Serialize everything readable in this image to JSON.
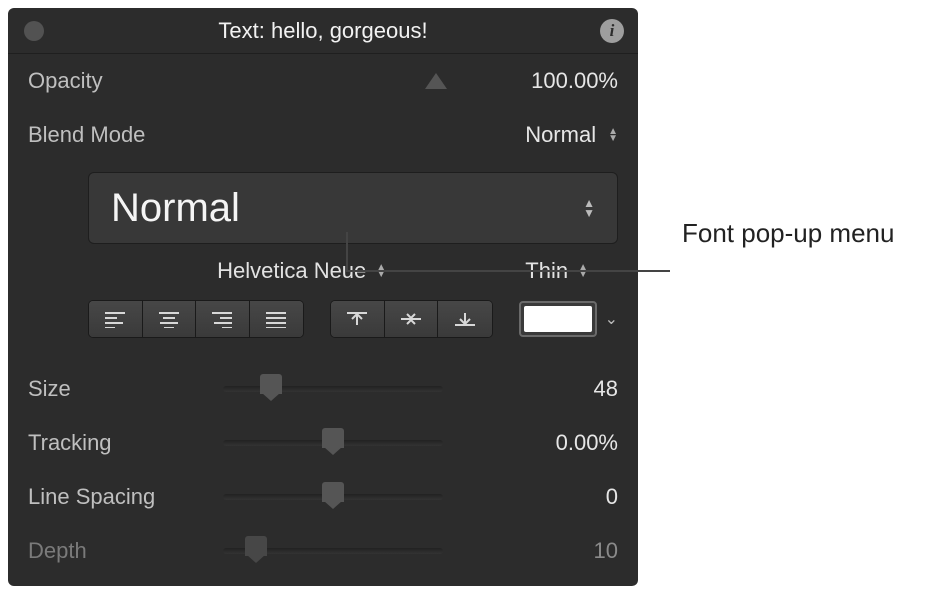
{
  "header": {
    "title": "Text: hello, gorgeous!"
  },
  "opacity": {
    "label": "Opacity",
    "value": "100.00%"
  },
  "blend_mode": {
    "label": "Blend Mode",
    "value": "Normal"
  },
  "preset": {
    "value": "Normal"
  },
  "font": {
    "family": "Helvetica Neue",
    "weight": "Thin"
  },
  "color": {
    "swatch": "#ffffff"
  },
  "size": {
    "label": "Size",
    "value": "48"
  },
  "tracking": {
    "label": "Tracking",
    "value": "0.00%"
  },
  "line_spacing": {
    "label": "Line Spacing",
    "value": "0"
  },
  "depth": {
    "label": "Depth",
    "value": "10"
  },
  "callout": {
    "text": "Font pop-up menu"
  }
}
